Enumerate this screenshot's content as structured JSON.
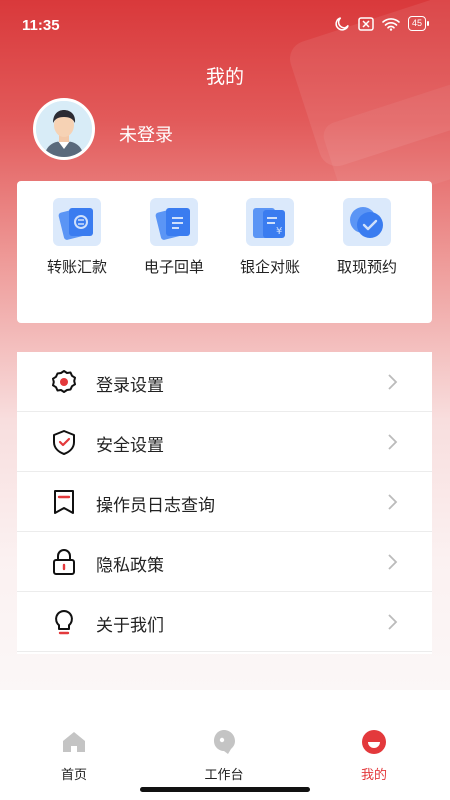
{
  "status_bar": {
    "time": "11:35",
    "battery": "45"
  },
  "header": {
    "title": "我的",
    "login_status": "未登录"
  },
  "quick_actions": [
    {
      "label": "转账汇款",
      "icon": "transfer-icon"
    },
    {
      "label": "电子回单",
      "icon": "e-receipt-icon"
    },
    {
      "label": "银企对账",
      "icon": "reconciliation-icon"
    },
    {
      "label": "取现预约",
      "icon": "cash-appointment-icon"
    }
  ],
  "menu": [
    {
      "label": "登录设置",
      "icon": "gear-icon"
    },
    {
      "label": "安全设置",
      "icon": "shield-icon"
    },
    {
      "label": "操作员日志查询",
      "icon": "bookmark-log-icon"
    },
    {
      "label": "隐私政策",
      "icon": "lock-icon"
    },
    {
      "label": "关于我们",
      "icon": "lightbulb-icon"
    }
  ],
  "tabs": [
    {
      "label": "首页",
      "icon": "home-icon",
      "active": false
    },
    {
      "label": "工作台",
      "icon": "workbench-icon",
      "active": false
    },
    {
      "label": "我的",
      "icon": "profile-icon",
      "active": true
    }
  ],
  "colors": {
    "accent": "#e3393c",
    "quick_icon_bg": "#dbe9fb",
    "quick_icon_blue": "#3a7cf0"
  }
}
